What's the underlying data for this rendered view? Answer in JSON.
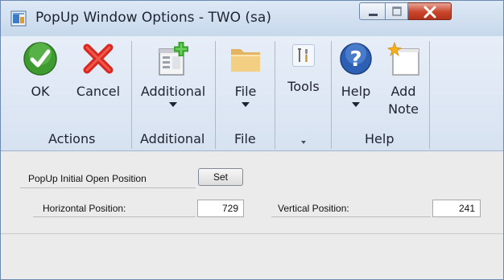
{
  "window": {
    "title": "PopUp Window Options  -  TWO (sa)",
    "app_icon": "dynamics-gp-icon",
    "controls": [
      "minimize-icon",
      "maximize-icon",
      "close-icon"
    ]
  },
  "ribbon": {
    "buttons": {
      "ok": {
        "label": "OK",
        "icon": "checkmark-icon"
      },
      "cancel": {
        "label": "Cancel",
        "icon": "x-icon"
      },
      "additional": {
        "label": "Additional",
        "icon": "window-add-icon"
      },
      "file": {
        "label": "File",
        "icon": "folder-icon"
      },
      "tools": {
        "label": "Tools",
        "icon": "tools-icon"
      },
      "help": {
        "label": "Help",
        "icon": "help-icon"
      },
      "add_note": {
        "label_line1": "Add",
        "label_line2": "Note",
        "icon": "note-icon"
      }
    },
    "groups": {
      "actions": "Actions",
      "additional": "Additional",
      "file": "File",
      "help": "Help"
    }
  },
  "form": {
    "initial_position_label": "PopUp Initial Open Position",
    "set_button": "Set",
    "horizontal_label": "Horizontal Position:",
    "horizontal_value": "729",
    "vertical_label": "Vertical Position:",
    "vertical_value": "241"
  },
  "colors": {
    "ribbon_bg": "#dce6f3",
    "content_bg": "#ebebeb",
    "close_red": "#c9452b"
  }
}
